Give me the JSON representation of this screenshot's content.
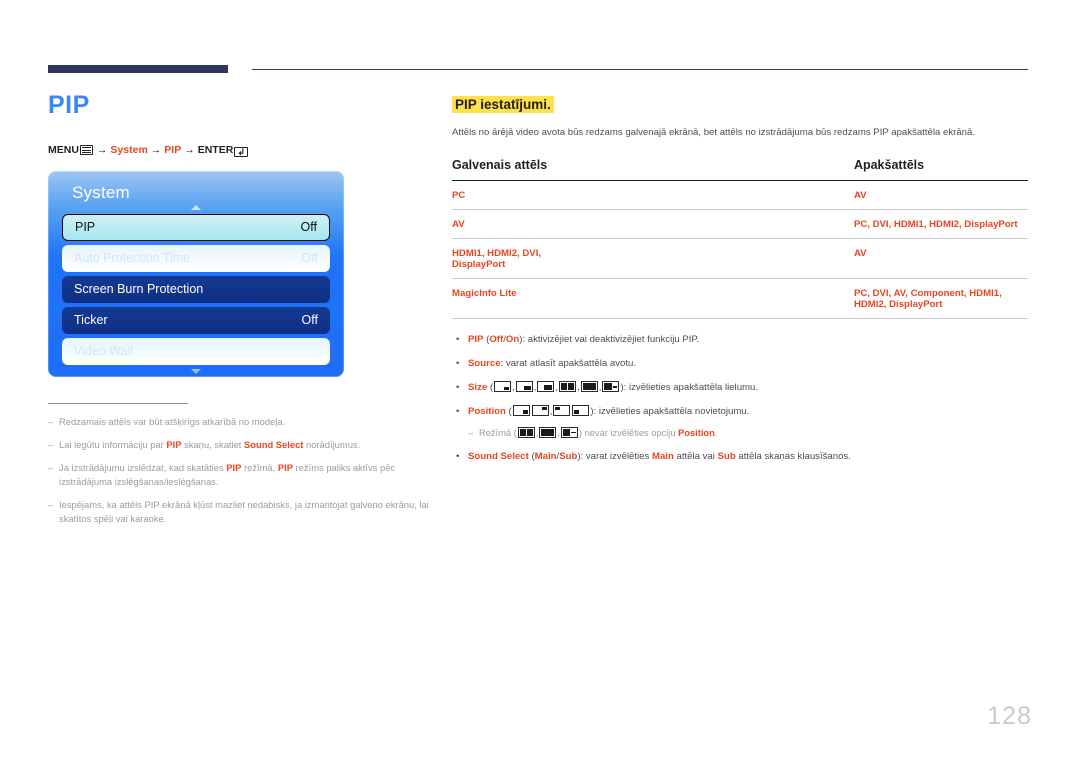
{
  "page": {
    "title": "PIP",
    "number": "128",
    "accent_color": "#e8451f",
    "title_color": "#3d87f5",
    "highlight_color": "#ffe14d"
  },
  "menu_path": {
    "menu_label": "MENU",
    "menu_icon": "menu-lines-icon",
    "arrow": "→",
    "step1": "System",
    "step2": "PIP",
    "enter_label": "ENTER",
    "enter_icon": "enter-key-icon",
    "enter_glyph": "↲"
  },
  "osd": {
    "title": "System",
    "caret_up": "up-caret-icon",
    "caret_down": "down-caret-icon",
    "rows": [
      {
        "label": "PIP",
        "value": "Off",
        "state": "selected"
      },
      {
        "label": "Auto Protection Time",
        "value": "Off",
        "state": "dim"
      },
      {
        "label": "Screen Burn Protection",
        "value": "",
        "state": "normal"
      },
      {
        "label": "Ticker",
        "value": "Off",
        "state": "normal"
      },
      {
        "label": "Video Wall",
        "value": "",
        "state": "dim"
      }
    ]
  },
  "notes": [
    {
      "dash": "–",
      "parts": [
        {
          "t": "Redzamais attēls var būt atšķirīgs atkarībā no modeļa."
        }
      ]
    },
    {
      "dash": "–",
      "parts": [
        {
          "t": "Lai iegūtu informāciju par "
        },
        {
          "t": "PIP",
          "b": true
        },
        {
          "t": " skaņu, skatiet "
        },
        {
          "t": "Sound Select",
          "b": true
        },
        {
          "t": " norādījumus."
        }
      ]
    },
    {
      "dash": "–",
      "parts": [
        {
          "t": "Ja izstrādājumu izslēdzat, kad skatāties "
        },
        {
          "t": "PIP",
          "b": true
        },
        {
          "t": " režīmā, "
        },
        {
          "t": "PIP",
          "b": true
        },
        {
          "t": " režīms paliks aktīvs pēc izstrādājuma izslēgšanas/ieslēgšanas."
        }
      ]
    },
    {
      "dash": "–",
      "parts": [
        {
          "t": "Iespējams, ka attēls PIP ekrānā kļūst mazliet nedabisks, ja izmantojat galveno ekrānu, lai skatītos spēļi vai karaoke."
        }
      ]
    }
  ],
  "right": {
    "section_heading": "PIP iestatījumi.",
    "intro": "Attēls no ārējā video avota būs redzams galvenajā ekrānā, bet attēls no izstrādājuma būs redzams PIP apakšattēla ekrānā.",
    "table": {
      "headers": [
        "Galvenais attēls",
        "Apakšattēls"
      ],
      "rows": [
        [
          "PC",
          "AV"
        ],
        [
          "AV",
          "PC, DVI, HDMI1, HDMI2, DisplayPort"
        ],
        [
          "HDMI1, HDMI2, DVI, DisplayPort",
          "AV"
        ],
        [
          "MagicInfo Lite",
          "PC, DVI, AV, Component, HDMI1, HDMI2, DisplayPort"
        ]
      ]
    },
    "bullets": {
      "pip": {
        "name": "PIP",
        "options": "(Off/On)",
        "opt_a": "Off",
        "opt_b": "On",
        "text": ": aktivizējiet vai deaktivizējiet funkciju PIP."
      },
      "source": {
        "name": "Source",
        "text": ": varat atlasīt apakšattēla avotu."
      },
      "size": {
        "name": "Size",
        "open": "(",
        "close": ")",
        "text": ": izvēlieties apakšattēla lielumu.",
        "icons": [
          "pip-size-small-icon",
          "pip-size-medium-icon",
          "pip-size-large-icon",
          "pip-split-half-icon",
          "pip-split-equal-icon",
          "pip-split-wide-icon"
        ]
      },
      "position": {
        "name": "Position",
        "open": "(",
        "close": ")",
        "text": ": izvēlieties apakšattēla novietojumu.",
        "icons": [
          "pip-pos-bottom-right-icon",
          "pip-pos-top-right-icon",
          "pip-pos-top-left-icon",
          "pip-pos-bottom-left-icon"
        ]
      },
      "position_note": {
        "dash": "–",
        "pre": "Režīmā (",
        "post": ") nevar izvēlēties opciju ",
        "bold": "Position",
        "end": ".",
        "icons": [
          "pip-split-half-icon",
          "pip-split-equal-icon",
          "pip-split-wide-icon"
        ]
      },
      "sound": {
        "name": "Sound Select",
        "options": "(Main/Sub)",
        "opt_a": "Main",
        "opt_b": "Sub",
        "mid": ": varat izvēlēties ",
        "bold1": "Main",
        "mid2": " attēla vai ",
        "bold2": "Sub",
        "end": " attēla skaņas klausīšanos."
      }
    }
  }
}
